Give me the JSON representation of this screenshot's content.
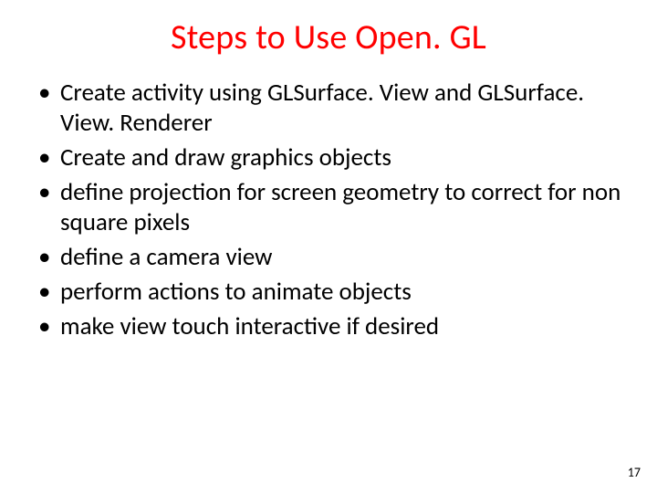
{
  "title": "Steps to Use Open. GL",
  "bullets": [
    "Create activity using GLSurface. View and GLSurface. View. Renderer",
    "Create and draw graphics objects",
    "define projection for screen geometry to correct for non square pixels",
    "define a camera view",
    "perform actions to animate objects",
    "make view touch interactive if desired"
  ],
  "page_number": "17"
}
